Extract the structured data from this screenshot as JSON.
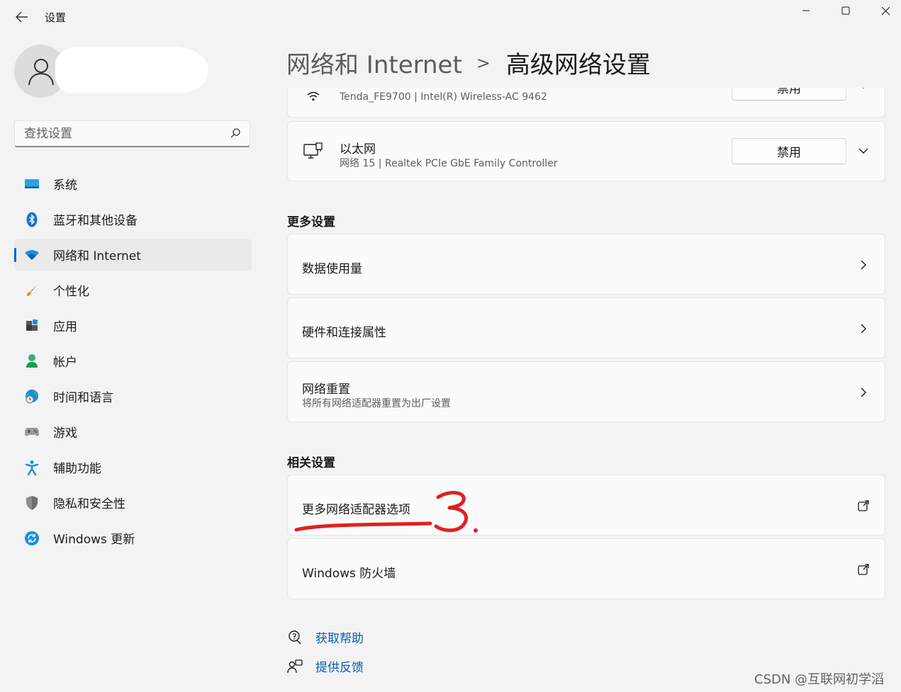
{
  "window": {
    "title": "设置",
    "minimize": "minimize-icon",
    "maximize": "maximize-icon",
    "close": "close-icon"
  },
  "search": {
    "placeholder": "查找设置"
  },
  "nav": {
    "items": [
      {
        "label": "系统",
        "icon": "monitor-icon"
      },
      {
        "label": "蓝牙和其他设备",
        "icon": "bluetooth-icon"
      },
      {
        "label": "网络和 Internet",
        "icon": "wifi-icon",
        "active": true
      },
      {
        "label": "个性化",
        "icon": "brush-icon"
      },
      {
        "label": "应用",
        "icon": "apps-icon"
      },
      {
        "label": "帐户",
        "icon": "account-icon"
      },
      {
        "label": "时间和语言",
        "icon": "globe-clock-icon"
      },
      {
        "label": "游戏",
        "icon": "gamepad-icon"
      },
      {
        "label": "辅助功能",
        "icon": "accessibility-icon"
      },
      {
        "label": "隐私和安全性",
        "icon": "shield-icon"
      },
      {
        "label": "Windows 更新",
        "icon": "update-icon"
      }
    ]
  },
  "header": {
    "parent": "网络和 Internet",
    "separator": ">",
    "current": "高级网络设置"
  },
  "adapters": [
    {
      "name": "",
      "detail": "Tenda_FE9700 | Intel(R) Wireless-AC 9462",
      "button": "禁用",
      "icon": "wifi-icon"
    },
    {
      "name": "以太网",
      "detail": "网络 15 | Realtek PCIe GbE Family Controller",
      "button": "禁用",
      "icon": "ethernet-icon"
    }
  ],
  "more_settings": {
    "title": "更多设置",
    "items": [
      {
        "label": "数据使用量"
      },
      {
        "label": "硬件和连接属性"
      },
      {
        "label": "网络重置",
        "sublabel": "将所有网络适配器重置为出厂设置"
      }
    ]
  },
  "related_settings": {
    "title": "相关设置",
    "items": [
      {
        "label": "更多网络适配器选项"
      },
      {
        "label": "Windows 防火墙"
      }
    ]
  },
  "help": {
    "get_help": "获取帮助",
    "feedback": "提供反馈"
  },
  "annotation": {
    "mark": "3."
  },
  "watermark": "CSDN @互联网初学滔",
  "colors": {
    "accent": "#0067c0",
    "link": "#0a5fb5",
    "annotation": "#e02020"
  }
}
